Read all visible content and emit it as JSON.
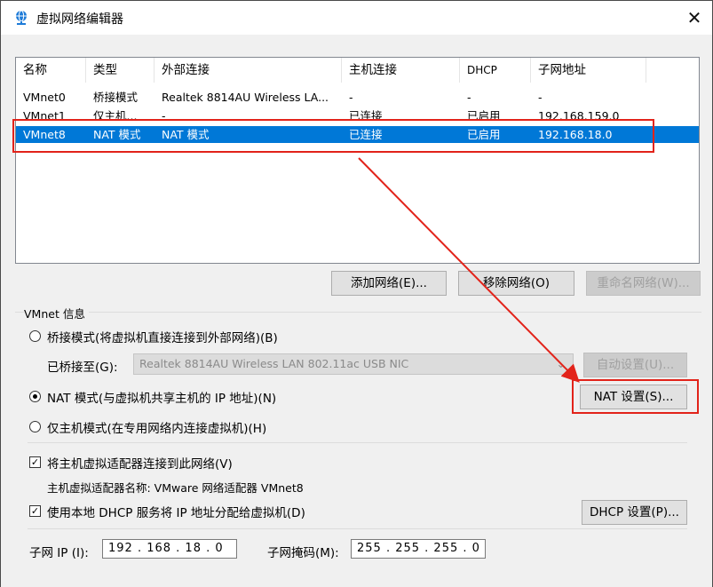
{
  "window": {
    "title": "虚拟网络编辑器",
    "close_glyph": "✕"
  },
  "table": {
    "columns": [
      "名称",
      "类型",
      "外部连接",
      "主机连接",
      "DHCP",
      "子网地址"
    ],
    "rows": [
      [
        "VMnet0",
        "桥接模式",
        "Realtek 8814AU Wireless LA...",
        "-",
        "-",
        "-"
      ],
      [
        "VMnet1",
        "仅主机...",
        "-",
        "已连接",
        "已启用",
        "192.168.159.0"
      ],
      [
        "VMnet8",
        "NAT 模式",
        "NAT 模式",
        "已连接",
        "已启用",
        "192.168.18.0"
      ]
    ],
    "selected_index": 2
  },
  "buttons": {
    "add": "添加网络(E)...",
    "remove": "移除网络(O)",
    "rename": "重命名网络(W)...",
    "auto": "自动设置(U)...",
    "nat": "NAT 设置(S)...",
    "dhcp": "DHCP 设置(P)..."
  },
  "info": {
    "group_label": "VMnet 信息",
    "bridge_label": "桥接模式(将虚拟机直接连接到外部网络)(B)",
    "bridged_to_label": "已桥接至(G):",
    "bridged_to_value": "Realtek 8814AU Wireless LAN 802.11ac USB NIC",
    "nat_label": "NAT 模式(与虚拟机共享主机的 IP 地址)(N)",
    "hostonly_label": "仅主机模式(在专用网络内连接虚拟机)(H)",
    "connect_adapter_label": "将主机虚拟适配器连接到此网络(V)",
    "adapter_name_label": "主机虚拟适配器名称: VMware 网络适配器 VMnet8",
    "use_dhcp_label": "使用本地 DHCP 服务将 IP 地址分配给虚拟机(D)",
    "subnet_ip_label": "子网 IP (I):",
    "subnet_ip_value": "192 . 168 . 18 . 0",
    "subnet_mask_label": "子网掩码(M):",
    "subnet_mask_value": "255 . 255 . 255 . 0",
    "selected_mode": "nat",
    "connect_adapter_checked": true,
    "use_dhcp_checked": true
  },
  "colors": {
    "selection": "#0078d7",
    "annotation": "#e2231a"
  }
}
